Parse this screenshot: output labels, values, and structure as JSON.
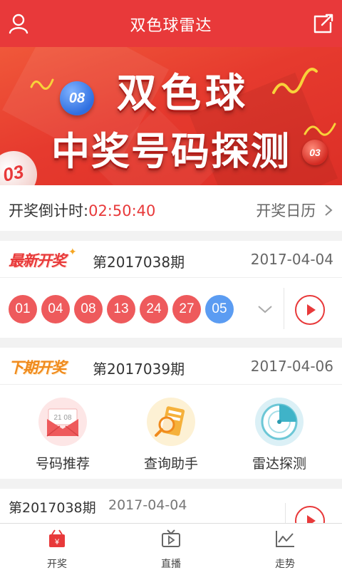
{
  "header": {
    "title": "双色球雷达",
    "left_icon": "user-icon",
    "right_icon": "share-icon"
  },
  "banner": {
    "line1": "双色球",
    "line2": "中奖号码探测",
    "ball_blue": "08",
    "ball_red": "03",
    "ball_small": "03"
  },
  "countdown": {
    "label": "开奖倒计时:",
    "time": "02:50:40",
    "calendar_link": "开奖日历"
  },
  "latest_draw": {
    "badge": "最新开奖",
    "period": "第2017038期",
    "date": "2017-04-04",
    "red_balls": [
      "01",
      "04",
      "08",
      "13",
      "24",
      "27"
    ],
    "blue_ball": "05",
    "colors": {
      "red_ball": "#ee5a5c",
      "blue_ball": "#5b9cf2"
    }
  },
  "next_draw": {
    "badge": "下期开奖",
    "period": "第2017039期",
    "date": "2017-04-06",
    "tools": [
      {
        "label": "号码推荐",
        "icon": "envelope-icon",
        "icon_text": "21 08"
      },
      {
        "label": "查询助手",
        "icon": "magnifier-document-icon"
      },
      {
        "label": "雷达探测",
        "icon": "radar-icon"
      }
    ]
  },
  "previous_row": {
    "period": "第2017038期",
    "date": "2017-04-04"
  },
  "tabbar": {
    "tabs": [
      {
        "label": "开奖",
        "icon": "lottery-box-icon",
        "active": true
      },
      {
        "label": "直播",
        "icon": "tv-play-icon",
        "active": false
      },
      {
        "label": "走势",
        "icon": "trend-chart-icon",
        "active": false
      }
    ]
  },
  "colors": {
    "brand": "#e8393a",
    "accent_orange": "#f08a1c"
  }
}
